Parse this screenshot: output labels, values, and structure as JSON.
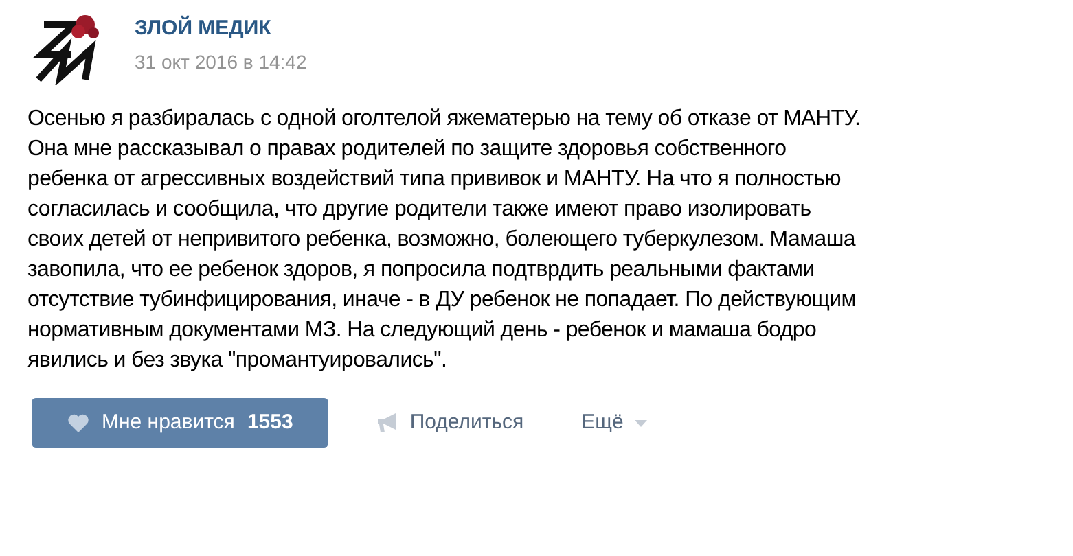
{
  "post": {
    "author": "ЗЛОЙ МЕДИК",
    "date": "31 окт 2016 в 14:42",
    "text_lines": [
      "Осенью я разбиралась с одной оголтелой яжематерью на тему об отказе от МАНТУ.",
      "Она мне рассказывал о правах родителей по защите здоровья собственного",
      "ребенка от агрессивных воздействий типа прививок и МАНТУ. На что я полностью",
      "согласилась и сообщила, что другие родители также имеют право изолировать",
      "своих детей от непривитого ребенка, возможно, болеющего туберкулезом. Мамаша",
      "завопила, что ее ребенок здоров, я попросила подтврдить реальными фактами",
      "отсутствие тубинфицирования, иначе - в ДУ ребенок не попадает. По действующим",
      "нормативным документами МЗ. На следующий день - ребенок и мамаша бодро",
      "явились и без звука \"промантуировались\"."
    ]
  },
  "actions": {
    "like": {
      "label": "Мне нравится",
      "count": "1553"
    },
    "share": {
      "label": "Поделиться"
    },
    "more": {
      "label": "Ещё"
    }
  }
}
